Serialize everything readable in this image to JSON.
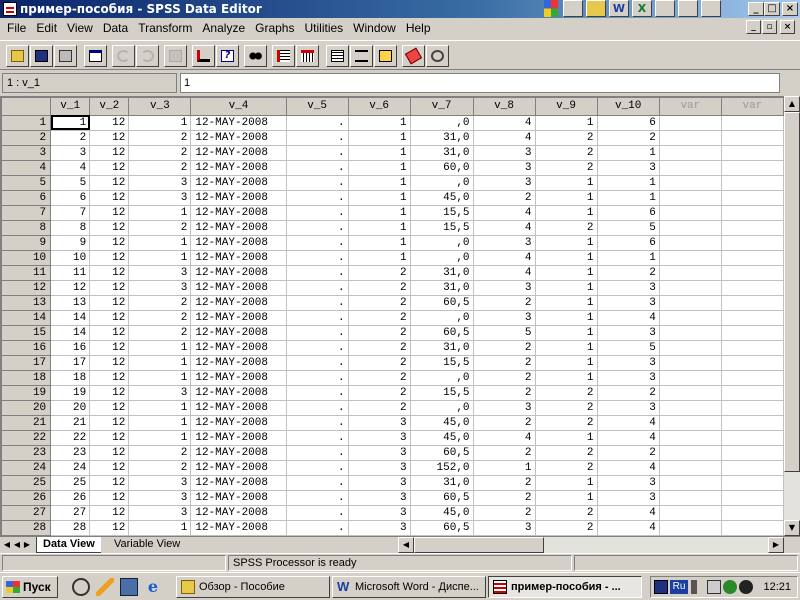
{
  "window": {
    "title": "пример-пособия - SPSS Data Editor",
    "minimize": "_",
    "maximize": "□",
    "close": "×"
  },
  "title_bar_icons": [
    "word-icon",
    "excel-icon",
    "desktop-icon",
    "search-icon",
    "image-icon"
  ],
  "title_bar_icon_letters": [
    "W",
    "X"
  ],
  "menu": [
    "File",
    "Edit",
    "View",
    "Data",
    "Transform",
    "Analyze",
    "Graphs",
    "Utilities",
    "Window",
    "Help"
  ],
  "toolbar": [
    "open-icon",
    "save-icon",
    "print-icon",
    "dialog-recall-icon",
    "undo-icon",
    "redo-icon",
    "goto-chart-icon",
    "goto-case-icon",
    "variables-icon",
    "find-icon",
    "insert-case-icon",
    "insert-variable-icon",
    "split-file-icon",
    "weight-cases-icon",
    "select-cases-icon",
    "value-labels-icon",
    "use-sets-icon"
  ],
  "cell_editor": {
    "reference": "1 : v_1",
    "value": "1"
  },
  "grid": {
    "columns": [
      "v_1",
      "v_2",
      "v_3",
      "v_4",
      "v_5",
      "v_6",
      "v_7",
      "v_8",
      "v_9",
      "v_10",
      "var",
      "var"
    ],
    "rows": [
      [
        "1",
        "12",
        "1",
        "12-MAY-2008",
        ".",
        "1",
        ",0",
        "4",
        "1",
        "6"
      ],
      [
        "2",
        "12",
        "2",
        "12-MAY-2008",
        ".",
        "1",
        "31,0",
        "4",
        "2",
        "2"
      ],
      [
        "3",
        "12",
        "2",
        "12-MAY-2008",
        ".",
        "1",
        "31,0",
        "3",
        "2",
        "1"
      ],
      [
        "4",
        "12",
        "2",
        "12-MAY-2008",
        ".",
        "1",
        "60,0",
        "3",
        "2",
        "3"
      ],
      [
        "5",
        "12",
        "3",
        "12-MAY-2008",
        ".",
        "1",
        ",0",
        "3",
        "1",
        "1"
      ],
      [
        "6",
        "12",
        "3",
        "12-MAY-2008",
        ".",
        "1",
        "45,0",
        "2",
        "1",
        "1"
      ],
      [
        "7",
        "12",
        "1",
        "12-MAY-2008",
        ".",
        "1",
        "15,5",
        "4",
        "1",
        "6"
      ],
      [
        "8",
        "12",
        "2",
        "12-MAY-2008",
        ".",
        "1",
        "15,5",
        "4",
        "2",
        "5"
      ],
      [
        "9",
        "12",
        "1",
        "12-MAY-2008",
        ".",
        "1",
        ",0",
        "3",
        "1",
        "6"
      ],
      [
        "10",
        "12",
        "1",
        "12-MAY-2008",
        ".",
        "1",
        ",0",
        "4",
        "1",
        "1"
      ],
      [
        "11",
        "12",
        "3",
        "12-MAY-2008",
        ".",
        "2",
        "31,0",
        "4",
        "1",
        "2"
      ],
      [
        "12",
        "12",
        "3",
        "12-MAY-2008",
        ".",
        "2",
        "31,0",
        "3",
        "1",
        "3"
      ],
      [
        "13",
        "12",
        "2",
        "12-MAY-2008",
        ".",
        "2",
        "60,5",
        "2",
        "1",
        "3"
      ],
      [
        "14",
        "12",
        "2",
        "12-MAY-2008",
        ".",
        "2",
        ",0",
        "3",
        "1",
        "4"
      ],
      [
        "14",
        "12",
        "2",
        "12-MAY-2008",
        ".",
        "2",
        "60,5",
        "5",
        "1",
        "3"
      ],
      [
        "16",
        "12",
        "1",
        "12-MAY-2008",
        ".",
        "2",
        "31,0",
        "2",
        "1",
        "5"
      ],
      [
        "17",
        "12",
        "1",
        "12-MAY-2008",
        ".",
        "2",
        "15,5",
        "2",
        "1",
        "3"
      ],
      [
        "18",
        "12",
        "1",
        "12-MAY-2008",
        ".",
        "2",
        ",0",
        "2",
        "1",
        "3"
      ],
      [
        "19",
        "12",
        "3",
        "12-MAY-2008",
        ".",
        "2",
        "15,5",
        "2",
        "2",
        "2"
      ],
      [
        "20",
        "12",
        "1",
        "12-MAY-2008",
        ".",
        "2",
        ",0",
        "3",
        "2",
        "3"
      ],
      [
        "21",
        "12",
        "1",
        "12-MAY-2008",
        ".",
        "3",
        "45,0",
        "2",
        "2",
        "4"
      ],
      [
        "22",
        "12",
        "1",
        "12-MAY-2008",
        ".",
        "3",
        "45,0",
        "4",
        "1",
        "4"
      ],
      [
        "23",
        "12",
        "2",
        "12-MAY-2008",
        ".",
        "3",
        "60,5",
        "2",
        "2",
        "2"
      ],
      [
        "24",
        "12",
        "2",
        "12-MAY-2008",
        ".",
        "3",
        "152,0",
        "1",
        "2",
        "4"
      ],
      [
        "25",
        "12",
        "3",
        "12-MAY-2008",
        ".",
        "3",
        "31,0",
        "2",
        "1",
        "3"
      ],
      [
        "26",
        "12",
        "3",
        "12-MAY-2008",
        ".",
        "3",
        "60,5",
        "2",
        "1",
        "3"
      ],
      [
        "27",
        "12",
        "3",
        "12-MAY-2008",
        ".",
        "3",
        "45,0",
        "2",
        "2",
        "4"
      ],
      [
        "28",
        "12",
        "1",
        "12-MAY-2008",
        ".",
        "3",
        "60,5",
        "3",
        "2",
        "4"
      ]
    ]
  },
  "tabs": [
    "Data View",
    "Variable View"
  ],
  "status": {
    "processor": "SPSS Processor  is ready"
  },
  "taskbar": {
    "start": "Пуск",
    "items": [
      "Обзор - Пособие",
      "Microsoft Word - Диспе...",
      "пример-пособия - ..."
    ],
    "language": "Ru",
    "clock": "12:21"
  }
}
